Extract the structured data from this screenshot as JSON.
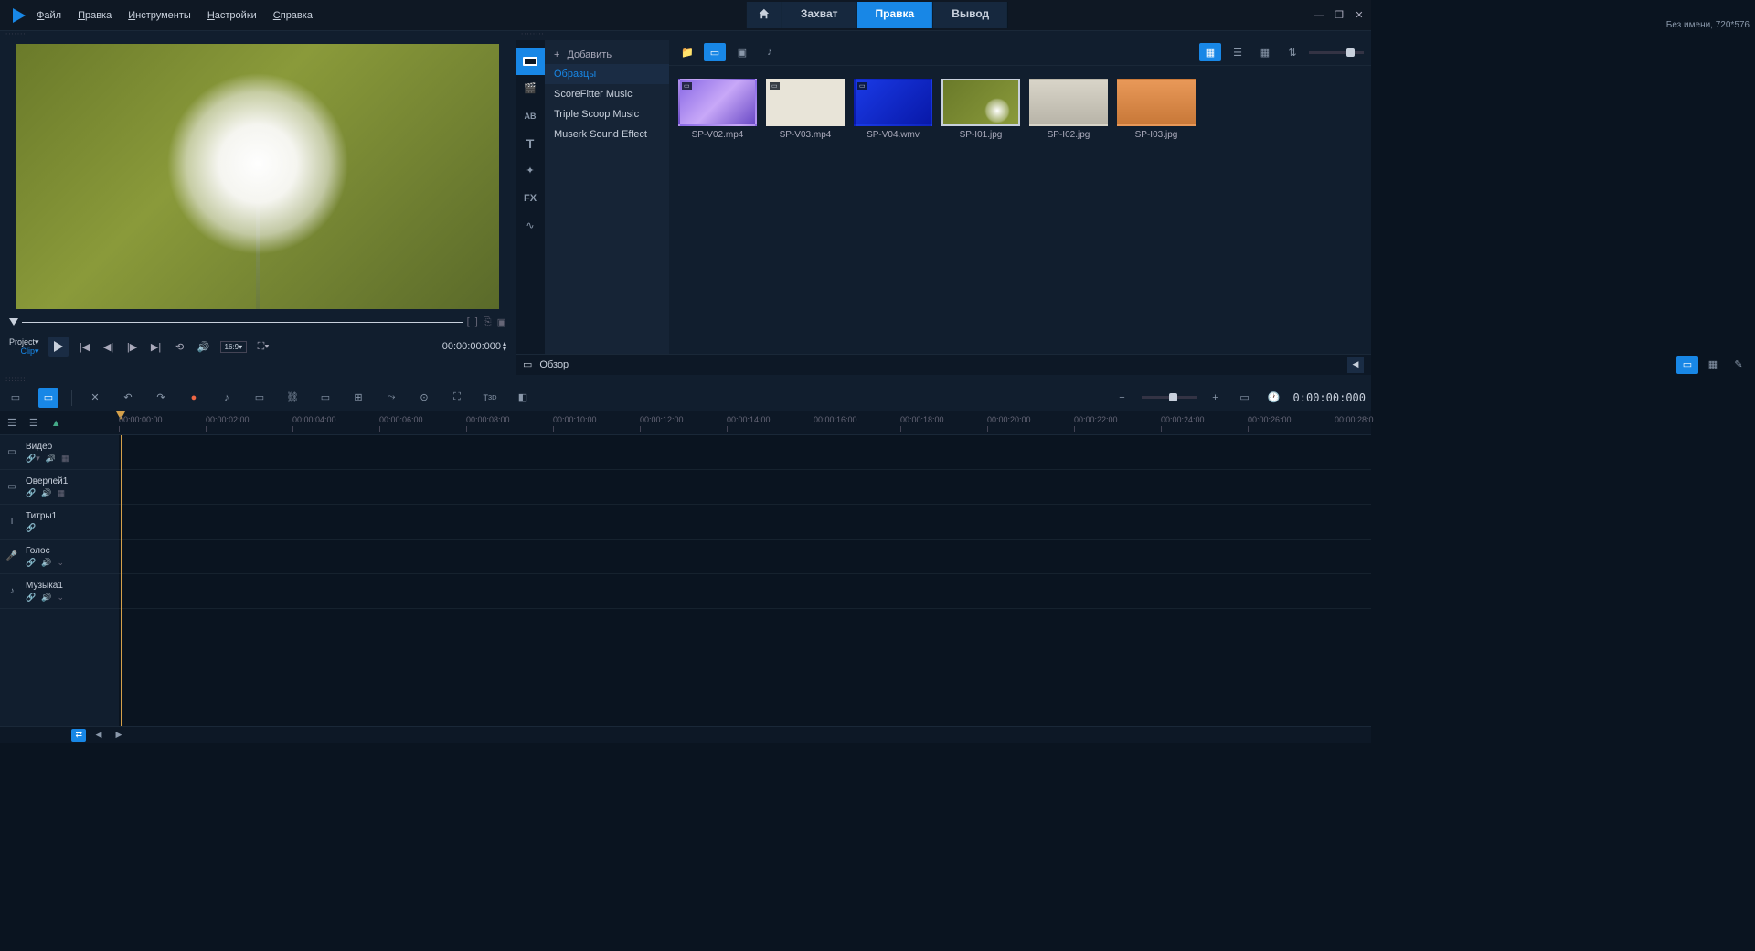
{
  "menu": {
    "file": "Файл",
    "edit": "Правка",
    "tools": "Инструменты",
    "settings": "Настройки",
    "help": "Справка"
  },
  "tabs": {
    "capture": "Захват",
    "edit": "Правка",
    "output": "Вывод"
  },
  "project_info": "Без имени, 720*576",
  "preview": {
    "project_label": "Project",
    "clip_label": "Clip",
    "aspect": "16:9",
    "timecode": "00:00:00:000"
  },
  "library": {
    "add": "Добавить",
    "categories": [
      "Образцы",
      "ScoreFitter Music",
      "Triple Scoop Music",
      "Muserk Sound Effect"
    ],
    "overview": "Обзор",
    "thumbs": [
      {
        "name": "SP-V02.mp4",
        "badge": "▭"
      },
      {
        "name": "SP-V03.mp4",
        "badge": "▭"
      },
      {
        "name": "SP-V04.wmv",
        "badge": "▭"
      },
      {
        "name": "SP-I01.jpg",
        "badge": ""
      },
      {
        "name": "SP-I02.jpg",
        "badge": ""
      },
      {
        "name": "SP-I03.jpg",
        "badge": ""
      }
    ]
  },
  "timeline": {
    "timecode": "0:00:00:000",
    "ruler": [
      "00:00:00:00",
      "00:00:02:00",
      "00:00:04:00",
      "00:00:06:00",
      "00:00:08:00",
      "00:00:10:00",
      "00:00:12:00",
      "00:00:14:00",
      "00:00:16:00",
      "00:00:18:00",
      "00:00:20:00",
      "00:00:22:00",
      "00:00:24:00",
      "00:00:26:00",
      "00:00:28:0"
    ],
    "tracks": [
      {
        "name": "Видео"
      },
      {
        "name": "Оверлей1"
      },
      {
        "name": "Титры1"
      },
      {
        "name": "Голос"
      },
      {
        "name": "Музыка1"
      }
    ]
  }
}
